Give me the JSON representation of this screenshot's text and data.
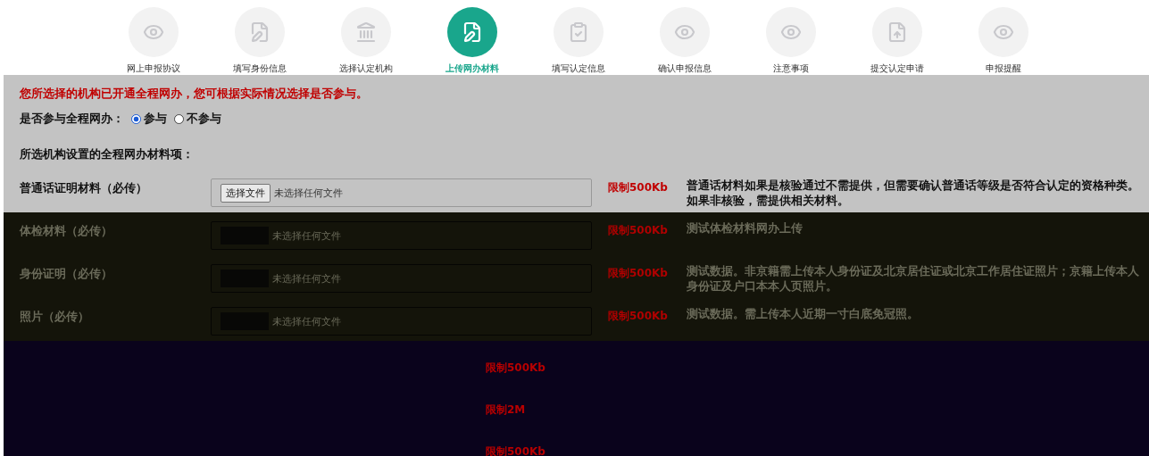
{
  "steps": [
    {
      "label": "网上申报协议",
      "selected": false
    },
    {
      "label": "填写身份信息",
      "selected": false
    },
    {
      "label": "选择认定机构",
      "selected": false
    },
    {
      "label": "上传网办材料",
      "selected": true
    },
    {
      "label": "填写认定信息",
      "selected": false
    },
    {
      "label": "确认申报信息",
      "selected": false
    },
    {
      "label": "注意事项",
      "selected": false
    },
    {
      "label": "提交认定申请",
      "selected": false
    },
    {
      "label": "申报提醒",
      "selected": false
    }
  ],
  "notice": "您所选择的机构已开通全程网办，您可根据实际情况选择是否参与。",
  "participate": {
    "label": "是否参与全程网办：",
    "options": [
      {
        "label": "参与",
        "selected": true
      },
      {
        "label": "不参与",
        "selected": false
      }
    ]
  },
  "section_title": "所选机构设置的全程网办材料项：",
  "materials": [
    {
      "kind": "visible",
      "label": "普通话证明材料（必传）",
      "button": "选择文件",
      "file_status": "未选择任何文件",
      "limit": "限制500Kb",
      "note": "普通话材料如果是核验通过不需提供，但需要确认普通话等级是否符合认定的资格种类。如果非核验，需提供相关材料。"
    },
    {
      "kind": "dimmed",
      "label": "体检材料（必传）",
      "file_status": "未选择任何文件",
      "limit": "限制500Kb",
      "note": "测试体检材料网办上传"
    },
    {
      "kind": "dimmed",
      "label": "身份证明（必传）",
      "file_status": "未选择任何文件",
      "limit": "限制500Kb",
      "note": "测试数据。非京籍需上传本人身份证及北京居住证或北京工作居住证照片；京籍上传本人身份证及户口本本人页照片。"
    },
    {
      "kind": "dimmed",
      "label": "照片（必传）",
      "file_status": "未选择任何文件",
      "limit": "限制500Kb",
      "note": "测试数据。需上传本人近期一寸白底免冠照。"
    },
    {
      "kind": "obscured",
      "limit": "限制500Kb"
    },
    {
      "kind": "obscured",
      "limit": "限制2M"
    },
    {
      "kind": "obscured",
      "limit": "限制500Kb"
    }
  ]
}
